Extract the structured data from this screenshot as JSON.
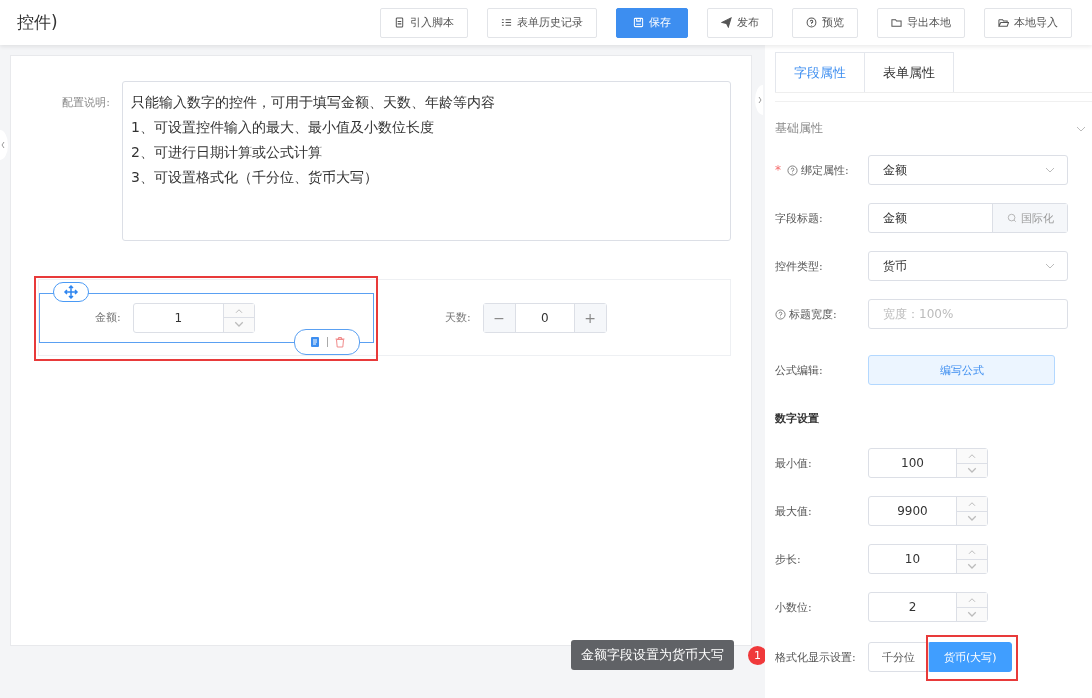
{
  "header": {
    "title": "控件)",
    "toolbar": [
      {
        "label": "引入脚本",
        "primary": false
      },
      {
        "label": "表单历史记录",
        "primary": false
      },
      {
        "label": "保存",
        "primary": true
      },
      {
        "label": "发布",
        "primary": false
      },
      {
        "label": "预览",
        "primary": false
      },
      {
        "label": "导出本地",
        "primary": false
      },
      {
        "label": "本地导入",
        "primary": false
      }
    ]
  },
  "canvas": {
    "description_label": "配置说明:",
    "description_lines": [
      "只能输入数字的控件，可用于填写金额、天数、年龄等内容",
      "1、可设置控件输入的最大、最小值及小数位长度",
      "2、可进行日期计算或公式计算",
      "3、可设置格式化（千分位、货币大写）"
    ],
    "fields": [
      {
        "kind": "spinner",
        "label": "金额:",
        "value": "1",
        "selected": true,
        "annotated": true
      },
      {
        "kind": "stepper",
        "label": "天数:",
        "value": "0",
        "minus": "−",
        "plus": "+",
        "selected": false,
        "annotated": false
      }
    ]
  },
  "panel": {
    "tabs": [
      {
        "label": "字段属性",
        "selected": true
      },
      {
        "label": "表单属性",
        "selected": false
      }
    ],
    "basic": {
      "title": "基础属性",
      "rows": [
        {
          "kind": "select",
          "label": "绑定属性:",
          "required_mark": "*",
          "help": true,
          "value": "金额"
        },
        {
          "kind": "input-addon",
          "label": "字段标题:",
          "help": false,
          "value": "金额",
          "addon": "国际化"
        },
        {
          "kind": "select",
          "label": "控件类型:",
          "help": false,
          "value": "货币"
        },
        {
          "kind": "input",
          "label": "标题宽度:",
          "help": true,
          "placeholder": "宽度：100%"
        },
        {
          "kind": "button",
          "label": "公式编辑:",
          "help": false,
          "button": "编写公式"
        }
      ]
    },
    "number": {
      "title": "数字设置",
      "rows": [
        {
          "label": "最小值:",
          "value": "100"
        },
        {
          "label": "最大值:",
          "value": "9900"
        },
        {
          "label": "步长:",
          "value": "10"
        },
        {
          "label": "小数位:",
          "value": "2"
        }
      ],
      "format": {
        "label": "格式化显示设置:",
        "options": [
          {
            "label": "千分位",
            "selected": false,
            "annotated": false
          },
          {
            "label": "货币(大写)",
            "selected": true,
            "annotated": true
          }
        ]
      }
    }
  },
  "callout": {
    "text": "金额字段设置为货币大写",
    "badge": "1"
  }
}
